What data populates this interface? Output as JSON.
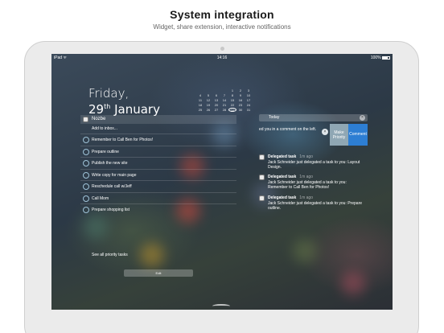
{
  "page": {
    "headline": "System integration",
    "subline": "Widget, share extension, interactive notifications"
  },
  "statusbar": {
    "carrier": "iPad ᯤ",
    "time": "14:16",
    "battery_percent": "100%"
  },
  "date": {
    "weekday": "Friday,",
    "day": "29",
    "day_suffix": "th",
    "month": "January"
  },
  "calendar": {
    "days": [
      "",
      "",
      "",
      "",
      "1",
      "2",
      "3",
      "4",
      "5",
      "6",
      "7",
      "8",
      "9",
      "10",
      "11",
      "12",
      "13",
      "14",
      "15",
      "16",
      "17",
      "18",
      "19",
      "20",
      "21",
      "22",
      "23",
      "24",
      "25",
      "26",
      "27",
      "28",
      "29",
      "30",
      "31"
    ],
    "today": "29"
  },
  "widget": {
    "app_name": "Nozbe",
    "add_inbox": "Add to inbox...",
    "tasks": [
      "Remember to Call Ben for Photos!",
      "Prepare outline",
      "Publish the new site",
      "Write copy for main page",
      "Reschedule call w/Jeff",
      "Call Mom",
      "Prepare shopping list"
    ],
    "see_all": "See all priority tasks",
    "edit_label": "Edit"
  },
  "notifications": {
    "today_label": "Today",
    "clear_label": "×",
    "swipe_text": "ed you in a comment on the left.",
    "swipe_dot": "×",
    "action_priority": "Make Priority",
    "action_comment": "Comment",
    "items": [
      {
        "title": "Delegated task",
        "time": "1m ago",
        "body": "Jack Schneider just delegated a task to you: Layout Design."
      },
      {
        "title": "Delegated task",
        "time": "1m ago",
        "body": "Jack Schneider just delegated a task to you: Remember to Call Ben for Photos!"
      },
      {
        "title": "Delegated task",
        "time": "1m ago",
        "body": "Jack Schneider just delegated a task to you: Prepare outline."
      }
    ]
  },
  "colors": {
    "comment_action": "#2d7ed3",
    "priority_action": "#8fa7b4",
    "task_circle": "#9fc3d8"
  }
}
